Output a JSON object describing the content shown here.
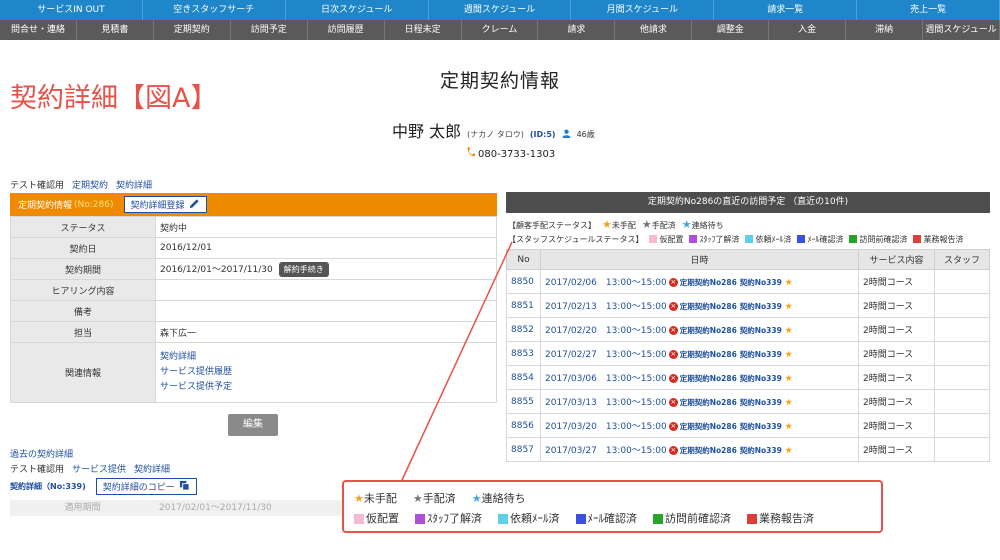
{
  "nav_top": [
    "サービスIN OUT",
    "空きスタッフサーチ",
    "日次スケジュール",
    "週間スケジュール",
    "月間スケジュール",
    "請求一覧",
    "売上一覧"
  ],
  "nav_sub": [
    "問合せ・連絡",
    "見積書",
    "定期契約",
    "訪問予定",
    "訪問履歴",
    "日程未定",
    "クレーム",
    "請求",
    "他請求",
    "調整金",
    "入金",
    "滞納",
    "週間スケジュール"
  ],
  "figure_label": "契約詳細【図A】",
  "page_title": "定期契約情報",
  "customer": {
    "name": "中野 太郎",
    "kana": "(ナカノ タロウ)",
    "id": "(ID:5)",
    "age": "46歳",
    "phone": "080-3733-1303"
  },
  "breadcrumb": [
    "テスト確認用",
    "定期契約",
    "契約詳細"
  ],
  "contract_panel": {
    "header_label": "定期契約情報",
    "header_no": "(No:286)",
    "register_button": "契約詳細登録",
    "rows": [
      {
        "key": "ステータス",
        "value": "契約中"
      },
      {
        "key": "契約日",
        "value": "2016/12/01"
      },
      {
        "key": "契約期間",
        "value": "2016/12/01～2017/11/30"
      },
      {
        "key": "ヒアリング内容",
        "value": ""
      },
      {
        "key": "備考",
        "value": ""
      },
      {
        "key": "担当",
        "value": "森下広一"
      }
    ],
    "cancel_button": "解約手続き",
    "related_key": "関連情報",
    "related_links": [
      "契約詳細",
      "サービス提供履歴",
      "サービス提供予定"
    ],
    "edit_button": "編集"
  },
  "past": {
    "title": "過去の契約詳細",
    "breadcrumb": [
      "テスト確認用",
      "サービス提供",
      "契約詳細"
    ],
    "detail_label": "契約詳細（No:339)",
    "copy_button": "契約詳細のコピー",
    "period_key": "適用期間",
    "period_value": "2017/02/01～2017/11/30"
  },
  "visits_panel": {
    "title": "定期契約No286の直近の訪問予定 （直近の10件)",
    "legend_customer_caption": "【顧客手配ステータス】",
    "legend_customer": [
      {
        "label": "未手配",
        "color": "#f3a21b"
      },
      {
        "label": "手配済",
        "color": "#777777"
      },
      {
        "label": "連絡待ち",
        "color": "#4aa3e0"
      }
    ],
    "legend_staff_caption": "【スタッフスケジュールステータス】",
    "legend_staff": [
      {
        "label": "仮配置",
        "color": "#f7b8d3"
      },
      {
        "label": "ｽﾀｯﾌ了解済",
        "color": "#b04fd8"
      },
      {
        "label": "依頼ﾒｰﾙ済",
        "color": "#5fd0e8"
      },
      {
        "label": "ﾒｰﾙ確認済",
        "color": "#3b4fe0"
      },
      {
        "label": "訪問前確認済",
        "color": "#28a428"
      },
      {
        "label": "業務報告済",
        "color": "#e23b3b"
      }
    ],
    "columns": [
      "No",
      "日時",
      "サービス内容",
      "スタッフ"
    ],
    "contract_link": "定期契約No286",
    "detail_link": "契約No339",
    "rows": [
      {
        "no": "8850",
        "datetime": "2017/02/06　13:00～15:00",
        "service": "2時間コース",
        "staff": ""
      },
      {
        "no": "8851",
        "datetime": "2017/02/13　13:00～15:00",
        "service": "2時間コース",
        "staff": ""
      },
      {
        "no": "8852",
        "datetime": "2017/02/20　13:00～15:00",
        "service": "2時間コース",
        "staff": ""
      },
      {
        "no": "8853",
        "datetime": "2017/02/27　13:00～15:00",
        "service": "2時間コース",
        "staff": ""
      },
      {
        "no": "8854",
        "datetime": "2017/03/06　13:00～15:00",
        "service": "2時間コース",
        "staff": ""
      },
      {
        "no": "8855",
        "datetime": "2017/03/13　13:00～15:00",
        "service": "2時間コース",
        "staff": ""
      },
      {
        "no": "8856",
        "datetime": "2017/03/20　13:00～15:00",
        "service": "2時間コース",
        "staff": ""
      },
      {
        "no": "8857",
        "datetime": "2017/03/27　13:00～15:00",
        "service": "2時間コース",
        "staff": ""
      }
    ]
  },
  "callout": {
    "row1": [
      {
        "label": "未手配",
        "color": "#f3a21b"
      },
      {
        "label": "手配済",
        "color": "#777777"
      },
      {
        "label": "連絡待ち",
        "color": "#4aa3e0"
      }
    ],
    "row2": [
      {
        "label": "仮配置",
        "color": "#f7b8d3"
      },
      {
        "label": "ｽﾀｯﾌ了解済",
        "color": "#b04fd8"
      },
      {
        "label": "依頼ﾒｰﾙ済",
        "color": "#5fd0e8"
      },
      {
        "label": "ﾒｰﾙ確認済",
        "color": "#3b4fe0"
      },
      {
        "label": "訪問前確認済",
        "color": "#28a428"
      },
      {
        "label": "業務報告済",
        "color": "#e23b3b"
      }
    ]
  }
}
